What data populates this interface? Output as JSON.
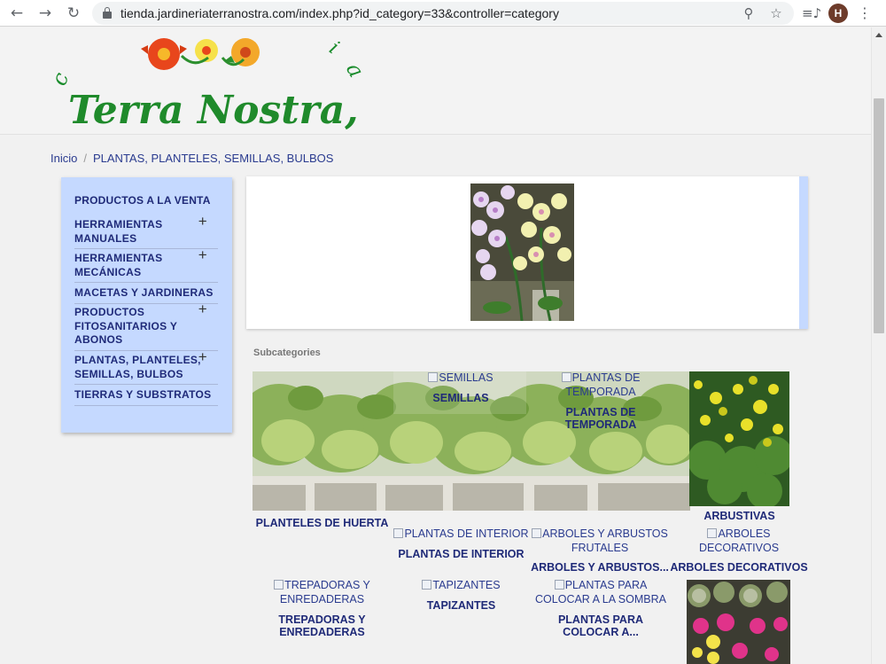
{
  "browser": {
    "url": "tienda.jardineriaterranostra.com/index.php?id_category=33&controller=category",
    "avatar_letter": "H",
    "icons": [
      "back-arrow",
      "forward-arrow",
      "reload",
      "lock",
      "zoom",
      "star",
      "media",
      "menu"
    ]
  },
  "logo": {
    "text": "Terra Nostra, s.l."
  },
  "breadcrumb": {
    "home": "Inicio",
    "separator": "/",
    "current": "PLANTAS, PLANTELES, SEMILLAS, BULBOS"
  },
  "sidebar": {
    "title": "PRODUCTOS A LA VENTA",
    "items": [
      {
        "label": "HERRAMIENTAS MANUALES",
        "expand": "+"
      },
      {
        "label": "HERRAMIENTAS MECÁNICAS",
        "expand": "+"
      },
      {
        "label": "MACETAS Y JARDINERAS"
      },
      {
        "label": "PRODUCTOS FITOSANITARIOS Y ABONOS",
        "expand": "+"
      },
      {
        "label": "PLANTAS, PLANTELES, SEMILLAS, BULBOS",
        "expand": "+"
      },
      {
        "label": "TIERRAS Y SUBSTRATOS"
      }
    ]
  },
  "main": {
    "subcategories_heading": "Subcategories",
    "subcategories": [
      {
        "name": "PLANTELES DE HUERTA",
        "image": "photo"
      },
      {
        "name": "SEMILLAS",
        "alt": "SEMILLAS"
      },
      {
        "name": "PLANTAS DE TEMPORADA",
        "alt": "PLANTAS DE TEMPORADA"
      },
      {
        "name": "ARBUSTIVAS",
        "image": "photo"
      },
      {
        "name": "PLANTAS DE INTERIOR",
        "alt": "PLANTAS DE INTERIOR"
      },
      {
        "name": "ARBOLES Y ARBUSTOS...",
        "alt": "ARBOLES Y ARBUSTOS FRUTALES"
      },
      {
        "name": "ARBOLES DECORATIVOS",
        "alt": "ARBOLES DECORATIVOS"
      },
      {
        "name": "TREPADORAS Y ENREDADERAS",
        "alt": "TREPADORAS Y ENREDADERAS"
      },
      {
        "name": "TAPIZANTES",
        "alt": "TAPIZANTES"
      },
      {
        "name": "PLANTAS PARA COLOCAR A...",
        "alt": "PLANTAS PARA COLOCAR A LA SOMBRA"
      },
      {
        "name": "",
        "image": "photo"
      }
    ]
  },
  "colors": {
    "sidebar_bg": "#c5d9ff",
    "link_dark": "#1f2a78",
    "breadcrumb_link": "#2a3b8f"
  }
}
